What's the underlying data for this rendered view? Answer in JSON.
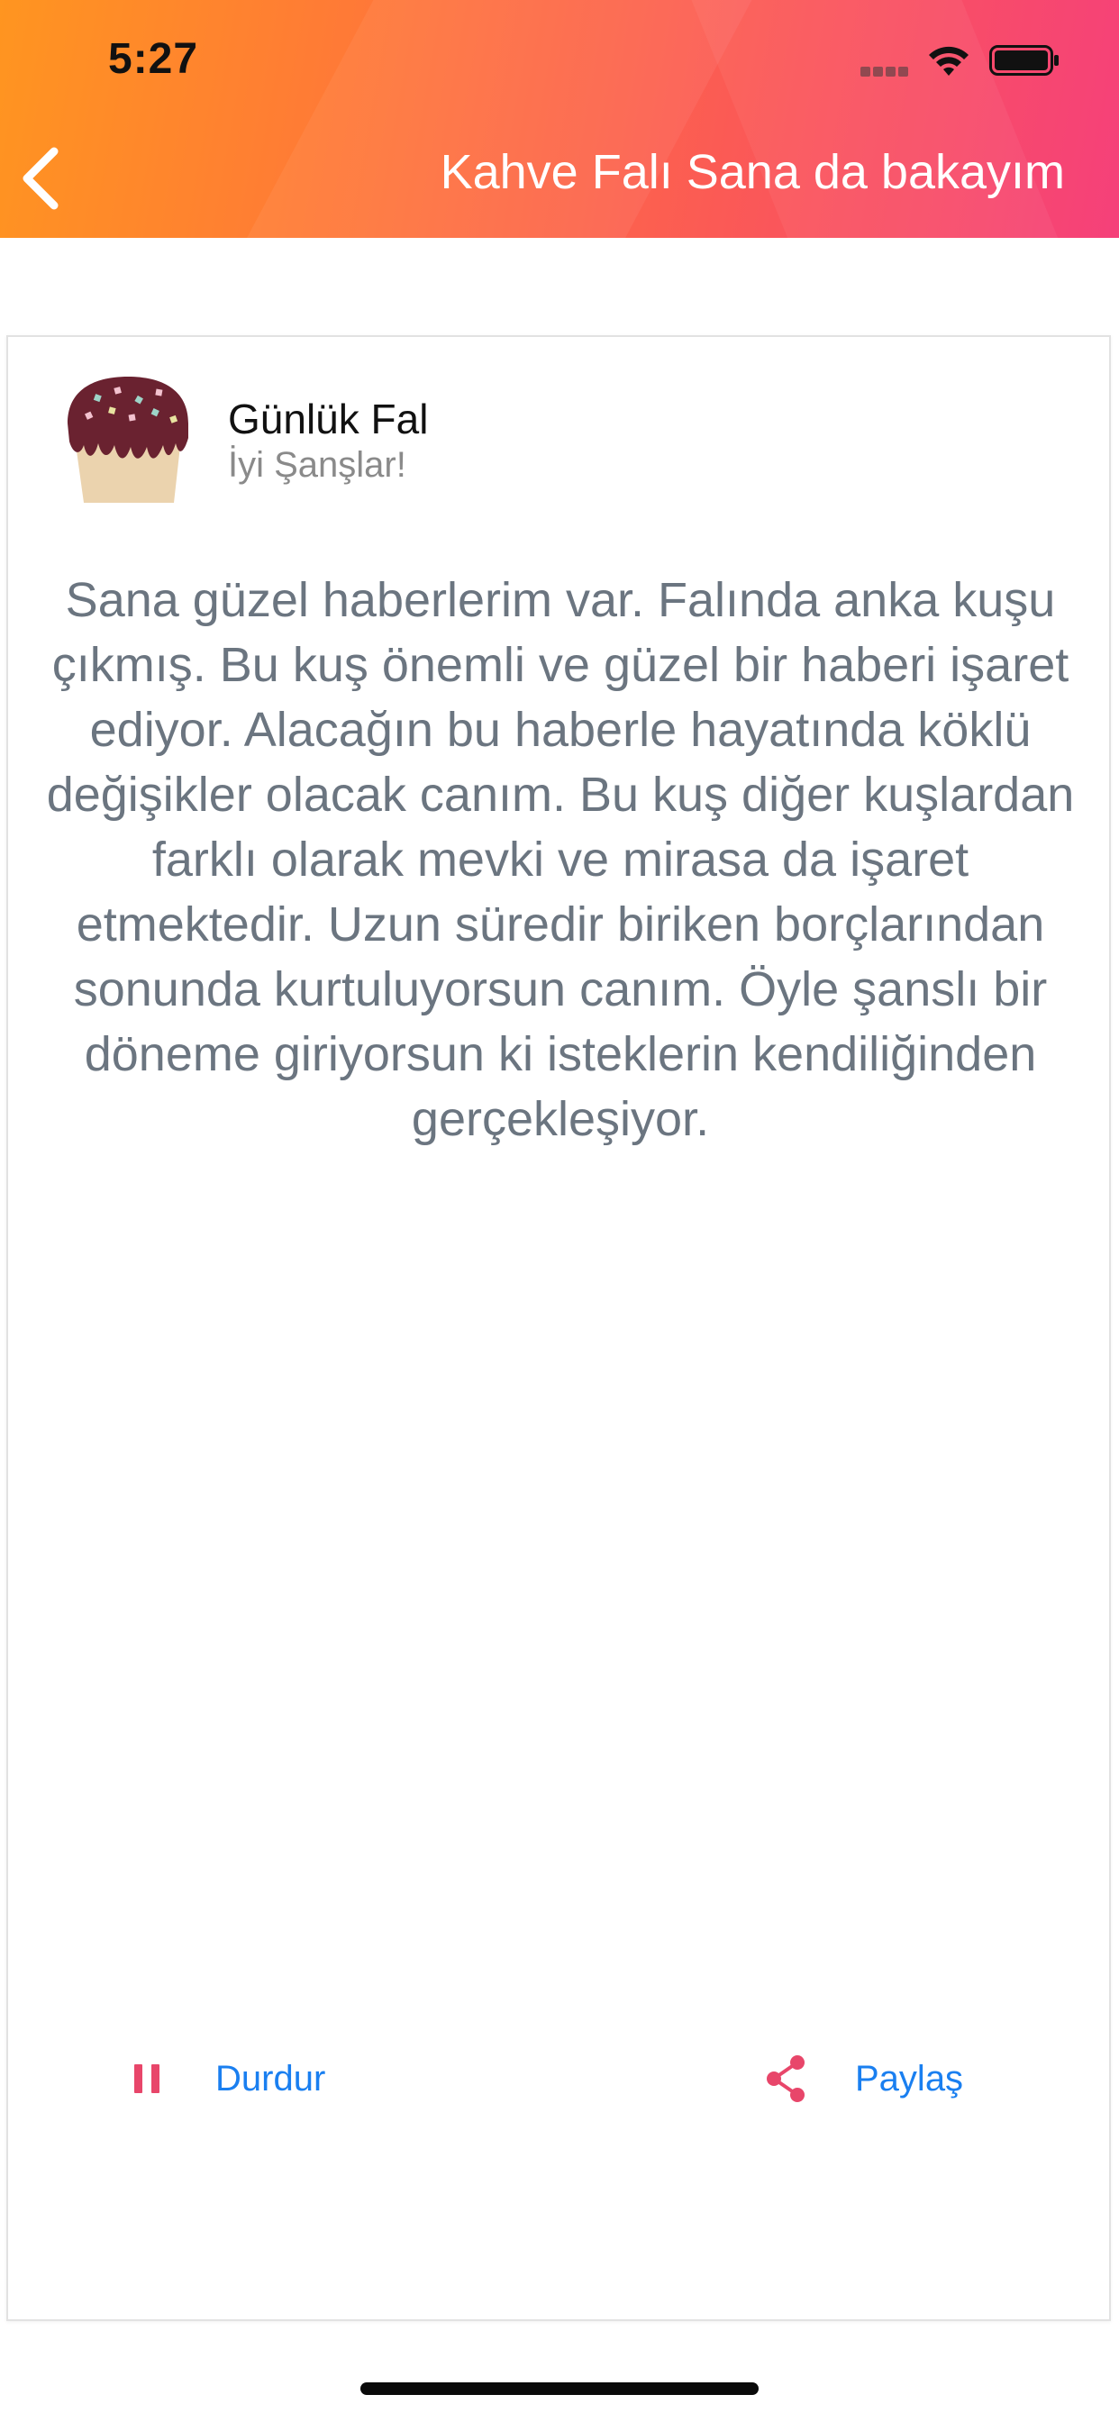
{
  "status_bar": {
    "time": "5:27",
    "icons": [
      "cellular-signal-icon",
      "wifi-icon",
      "battery-icon"
    ]
  },
  "navbar": {
    "back_icon": "chevron-left-icon",
    "title": "Kahve Falı Sana da bakayım"
  },
  "colors": {
    "header_gradient_start": "#ff9520",
    "header_gradient_end": "#f5407a",
    "link_blue": "#1a7ff0",
    "icon_pink": "#e8466a",
    "body_text": "#6b7580"
  },
  "card": {
    "avatar_icon": "cupcake-icon",
    "title": "Günlük Fal",
    "subtitle": "İyi Şanşlar!",
    "text": "Sana güzel haberlerim var. Falında anka kuşu çıkmış. Bu kuş önemli ve güzel bir haberi işaret ediyor. Alacağın bu haberle hayatında köklü değişikler olacak canım. Bu kuş diğer kuşlardan farklı olarak mevki ve mirasa da işaret etmektedir. Uzun süredir biriken borçlarından sonunda kurtuluyorsun canım. Öyle şanslı bir döneme giriyorsun ki isteklerin kendiliğinden gerçekleşiyor.",
    "controls": {
      "pause": {
        "icon": "pause-icon",
        "label": "Durdur"
      },
      "share": {
        "icon": "share-icon",
        "label": "Paylaş"
      }
    }
  }
}
